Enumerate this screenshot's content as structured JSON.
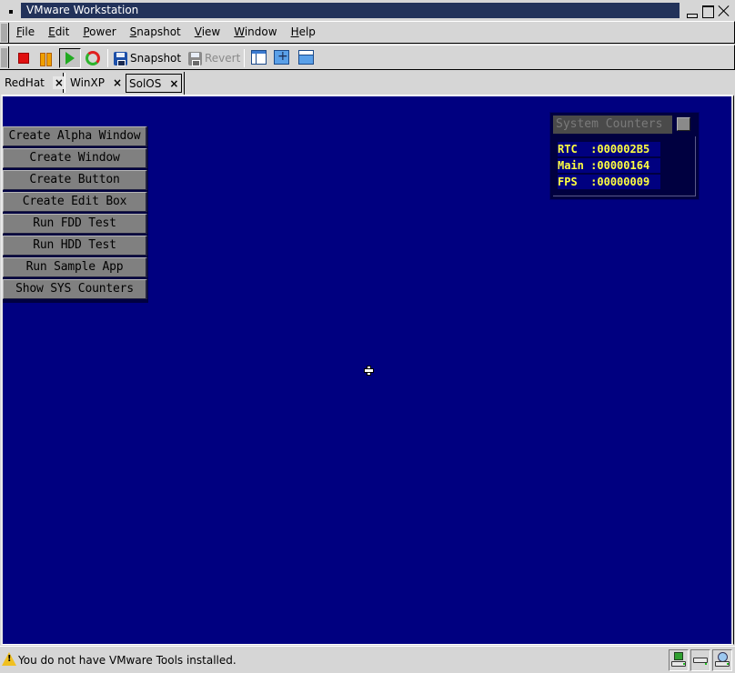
{
  "window": {
    "title": "VMware Workstation"
  },
  "menubar": {
    "items": [
      {
        "label": "File",
        "mnemonic": "F",
        "rest": "ile"
      },
      {
        "label": "Edit",
        "mnemonic": "E",
        "rest": "dit"
      },
      {
        "label": "Power",
        "mnemonic": "P",
        "rest": "ower"
      },
      {
        "label": "Snapshot",
        "mnemonic": "S",
        "rest": "napshot"
      },
      {
        "label": "View",
        "mnemonic": "V",
        "rest": "iew"
      },
      {
        "label": "Window",
        "mnemonic": "W",
        "rest": "indow"
      },
      {
        "label": "Help",
        "mnemonic": "H",
        "rest": "elp"
      }
    ]
  },
  "toolbar": {
    "stop_icon": "stop-icon",
    "pause_icon": "pause-icon",
    "play_icon": "play-icon",
    "reset_icon": "reset-icon",
    "snapshot_label": "Snapshot",
    "revert_label": "Revert",
    "sidebar_icon": "sidebar-icon",
    "fullscreen_icon": "fullscreen-icon",
    "quickswitch_icon": "quick-switch-icon"
  },
  "tabs": [
    {
      "label": "RedHat",
      "close": "×",
      "active": false
    },
    {
      "label": "WinXP",
      "close": "×",
      "active": false
    },
    {
      "label": "SolOS",
      "close": "×",
      "active": true
    }
  ],
  "guest": {
    "menu_buttons": [
      "Create Alpha Window",
      "Create Window",
      "Create Button",
      "Create Edit Box",
      "Run FDD Test",
      "Run HDD Test",
      "Run Sample App",
      "Show SYS Counters"
    ],
    "counters": {
      "title": "System Counters",
      "rows": [
        {
          "label": "RTC ",
          "value": ":000002B5"
        },
        {
          "label": "Main",
          "value": ":00000164"
        },
        {
          "label": "FPS ",
          "value": ":00000009"
        }
      ]
    },
    "colors": {
      "desktop": "#000080",
      "button_face": "#808080",
      "counter_text": "#ffff40"
    }
  },
  "statusbar": {
    "message": "You do not have VMware Tools installed.",
    "devices": [
      "floppy-drive-icon",
      "hard-disk-icon",
      "cdrom-drive-icon"
    ]
  }
}
